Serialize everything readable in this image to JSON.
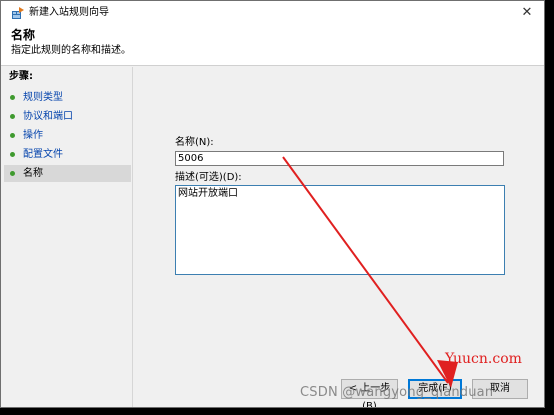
{
  "window": {
    "title": "新建入站规则向导",
    "close_glyph": "✕"
  },
  "header": {
    "title": "名称",
    "description": "指定此规则的名称和描述。"
  },
  "steps": {
    "title": "步骤:",
    "items": [
      {
        "label": "规则类型"
      },
      {
        "label": "协议和端口"
      },
      {
        "label": "操作"
      },
      {
        "label": "配置文件"
      },
      {
        "label": "名称"
      }
    ]
  },
  "form": {
    "name_label": "名称(N):",
    "name_value": "5006",
    "desc_label": "描述(可选)(D):",
    "desc_value": "网站开放端口"
  },
  "buttons": {
    "back": "< 上一步(B)",
    "finish": "完成(F)",
    "cancel": "取消"
  },
  "watermarks": {
    "yuucn": "Yuucn.com",
    "csdn": "CSDN @wangyong_qianduan"
  },
  "colors": {
    "link": "#0645ad",
    "annotation_arrow": "#e02020",
    "step_bullet": "#3f9a2f"
  }
}
